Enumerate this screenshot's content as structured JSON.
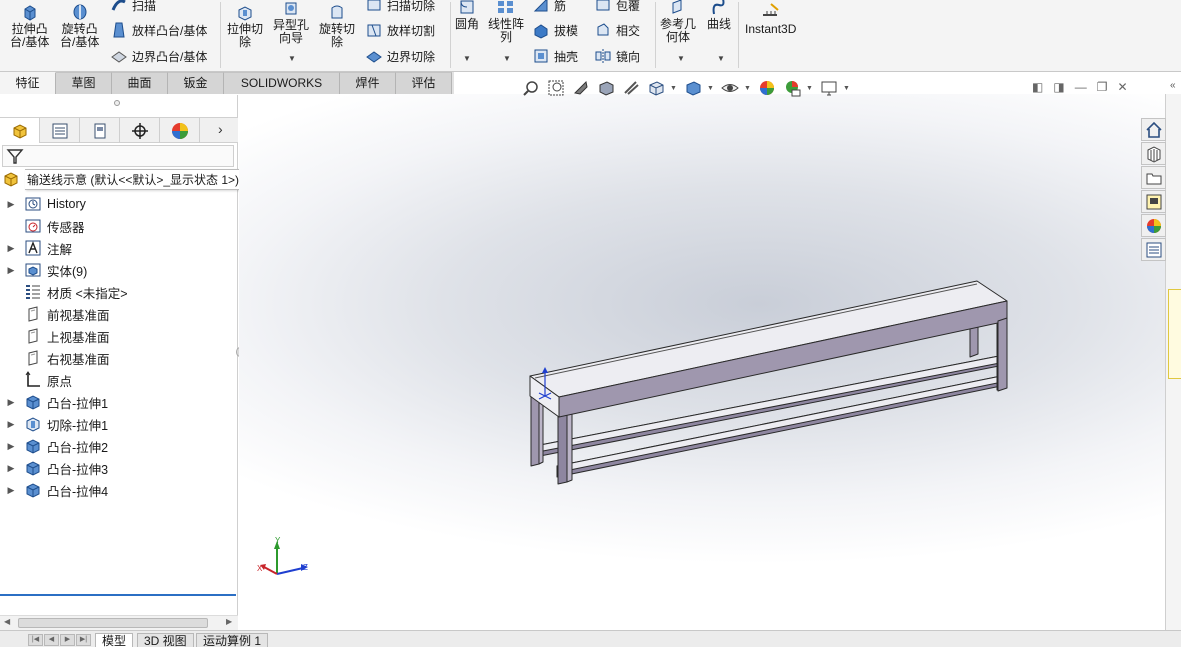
{
  "ribbon": {
    "extrude_boss": "拉伸凸\n台/基体",
    "revolve_boss": "旋转凸\n台/基体",
    "sweep": "扫描",
    "loft_boss": "放样凸台/基体",
    "boundary_boss": "边界凸台/基体",
    "extrude_cut": "拉伸切\n除",
    "hole_wizard": "异型孔\n向导",
    "revolve_cut": "旋转切\n除",
    "sweep_cut": "扫描切除",
    "loft_cut": "放样切割",
    "boundary_cut": "边界切除",
    "fillet": "圆角",
    "linear_pattern": "线性阵\n列",
    "rib": "筋",
    "draft": "拔模",
    "shell": "抽壳",
    "wrap": "包覆",
    "intersect": "相交",
    "mirror": "镜向",
    "ref_geometry": "参考几\n何体",
    "curves": "曲线",
    "instant3d": "Instant3D"
  },
  "tabs": [
    "特征",
    "草图",
    "曲面",
    "钣金",
    "SOLIDWORKS MBD",
    "焊件(D)",
    "评估"
  ],
  "tree": {
    "root": "输送线示意  (默认<<默认>_显示状态 1>)",
    "items": [
      {
        "label": "History",
        "expand": true,
        "icon": "history-icon"
      },
      {
        "label": "传感器",
        "expand": false,
        "icon": "sensor-icon"
      },
      {
        "label": "注解",
        "expand": true,
        "icon": "annotation-icon"
      },
      {
        "label": "实体(9)",
        "expand": true,
        "icon": "solid-bodies-icon"
      },
      {
        "label": "材质 <未指定>",
        "expand": false,
        "icon": "material-icon"
      },
      {
        "label": "前视基准面",
        "expand": false,
        "icon": "plane-icon"
      },
      {
        "label": "上视基准面",
        "expand": false,
        "icon": "plane-icon"
      },
      {
        "label": "右视基准面",
        "expand": false,
        "icon": "plane-icon"
      },
      {
        "label": "原点",
        "expand": false,
        "icon": "origin-icon"
      },
      {
        "label": "凸台-拉伸1",
        "expand": true,
        "icon": "extrude-boss-icon"
      },
      {
        "label": "切除-拉伸1",
        "expand": true,
        "icon": "extrude-cut-icon"
      },
      {
        "label": "凸台-拉伸2",
        "expand": true,
        "icon": "extrude-boss-icon"
      },
      {
        "label": "凸台-拉伸3",
        "expand": true,
        "icon": "extrude-boss-icon"
      },
      {
        "label": "凸台-拉伸4",
        "expand": true,
        "icon": "extrude-boss-icon"
      }
    ]
  },
  "triad": {
    "x": "X",
    "y": "Y",
    "z": "Z"
  },
  "bottom_tabs": [
    "模型",
    "3D 视图",
    "运动算例 1"
  ],
  "colors": {
    "accent": "#2b6fc4",
    "model_face": "#ededf2",
    "model_side": "#9f97ae"
  }
}
